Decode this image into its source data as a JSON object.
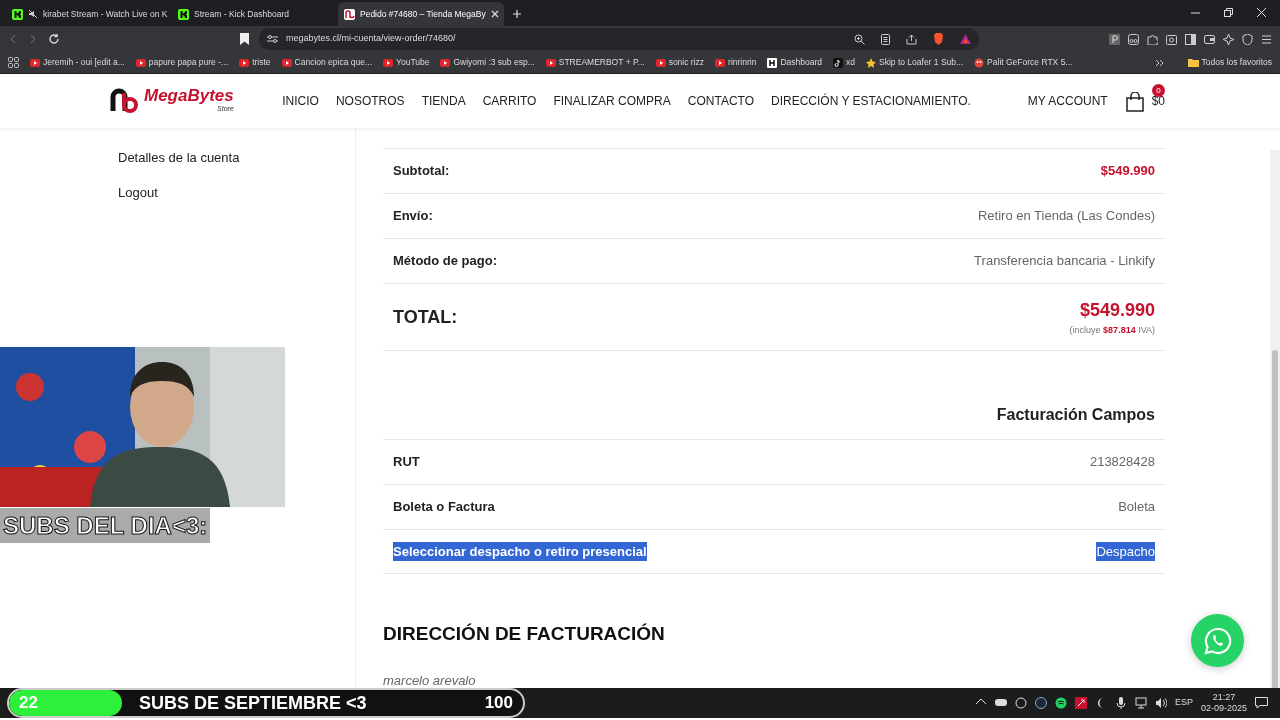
{
  "browser": {
    "tabs": [
      {
        "title": "kirabet Stream - Watch Live on K",
        "muted": true,
        "selected": false
      },
      {
        "title": "Stream - Kick Dashboard",
        "muted": false,
        "selected": false
      },
      {
        "title": "Pedido #74680 – Tienda MegaBy",
        "muted": false,
        "selected": true
      }
    ],
    "address": "megabytes.cl/mi-cuenta/view-order/74680/",
    "bookmarks": [
      {
        "label": "Jeremih - oui [edit a..."
      },
      {
        "label": "papure papa pure -..."
      },
      {
        "label": "triste"
      },
      {
        "label": "Cancion epica que..."
      },
      {
        "label": "YouTube"
      },
      {
        "label": "Gwiyomi :3 sub esp..."
      },
      {
        "label": "STREAMERBOT + P..."
      },
      {
        "label": "sonic rizz"
      },
      {
        "label": "rinrinrin"
      },
      {
        "label": "Dashboard"
      },
      {
        "label": "xd"
      },
      {
        "label": "Skip to Loafer 1 Sub..."
      },
      {
        "label": "Palit GeForce RTX 5..."
      }
    ],
    "all_bookmarks": "Todos los favoritos"
  },
  "site": {
    "logo": {
      "name": "MegaBytes",
      "sub": "Store"
    },
    "nav": [
      "INICIO",
      "NOSOTROS",
      "TIENDA",
      "CARRITO",
      "FINALIZAR COMPRA",
      "CONTACTO",
      "DIRECCIÓN Y ESTACIONAMIENTO."
    ],
    "account": "MY ACCOUNT",
    "cart_count": "0",
    "cart_total": "$0"
  },
  "sidebar": {
    "items": [
      "Detalles de la cuenta",
      "Logout"
    ]
  },
  "totals": [
    {
      "kind": "price",
      "label": "Subtotal:",
      "value": "$549.990"
    },
    {
      "kind": "plain",
      "label": "Envío:",
      "value": "Retiro en Tienda (Las Condes)"
    },
    {
      "kind": "plain",
      "label": "Método de pago:",
      "value": "Transferencia bancaria - Linkify"
    },
    {
      "kind": "total",
      "label": "TOTAL:",
      "value": "$549.990",
      "note_before": "(incluye ",
      "note_amount": "$87.814",
      "note_after": " IVA)"
    }
  ],
  "billing_fields": {
    "heading": "Facturación Campos",
    "rows": [
      {
        "label": "RUT",
        "value": "213828428",
        "highlighted": false
      },
      {
        "label": "Boleta o Factura",
        "value": "Boleta",
        "highlighted": false
      },
      {
        "label": "Seleccionar despacho o retiro presencial",
        "value": "Despacho",
        "highlighted": true
      }
    ]
  },
  "billing_address": {
    "heading": "DIRECCIÓN DE FACTURACIÓN",
    "name": "marcelo arevalo"
  },
  "overlay": {
    "subs_day": "SUBS DEL DIA<3:",
    "goal": {
      "current": "22",
      "label": "SUBS DE SEPTIEMBRE <3",
      "target": "100",
      "level": 0.22
    }
  },
  "taskbar": {
    "language": "ESP",
    "time": "21:27",
    "date": "02-09-2025"
  }
}
